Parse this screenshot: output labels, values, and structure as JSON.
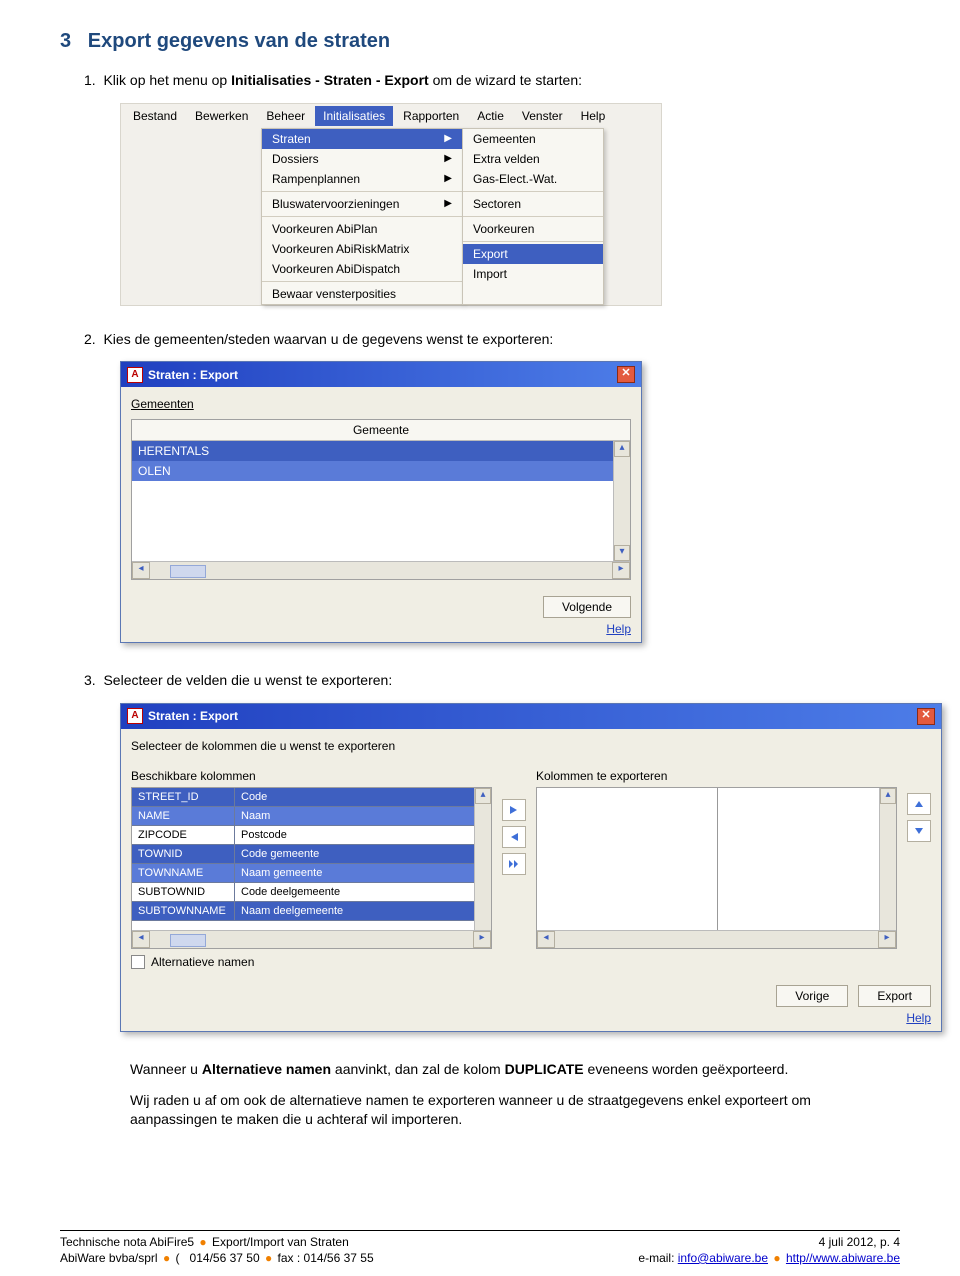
{
  "section": {
    "num": "3",
    "title": "Export gegevens van de straten"
  },
  "steps": {
    "s1a": "Klik op het menu op ",
    "s1b": "Initialisaties - Straten - Export",
    "s1c": " om de wizard te starten:",
    "s2": "Kies de gemeenten/steden waarvan u de gegevens wenst te exporteren:",
    "s3": "Selecteer de velden die u wenst te exporteren:"
  },
  "menubar": {
    "t1": "Bestand",
    "t2": "Bewerken",
    "t3": "Beheer",
    "t4": "Initialisaties",
    "t5": "Rapporten",
    "t6": "Actie",
    "t7": "Venster",
    "t8": "Help"
  },
  "dd1": {
    "straten": "Straten",
    "dossiers": "Dossiers",
    "rampen": "Rampenplannen",
    "blus": "Bluswatervoorzieningen",
    "vk1": "Voorkeuren AbiPlan",
    "vk2": "Voorkeuren AbiRiskMatrix",
    "vk3": "Voorkeuren AbiDispatch",
    "bewaar": "Bewaar vensterposities"
  },
  "dd2": {
    "gemeenten": "Gemeenten",
    "extra": "Extra velden",
    "gas": "Gas-Elect.-Wat.",
    "sectoren": "Sectoren",
    "voorkeuren": "Voorkeuren",
    "export": "Export",
    "import": "Import"
  },
  "dlg1": {
    "title": "Straten : Export",
    "tabGemeenten": "Gemeenten",
    "colhdr": "Gemeente",
    "row1": "HERENTALS",
    "row2": "OLEN",
    "btnVolgende": "Volgende",
    "help": "Help"
  },
  "dlg2": {
    "title": "Straten : Export",
    "prompt": "Selecteer de kolommen die u wenst te exporteren",
    "leftlbl": "Beschikbare kolommen",
    "rightlbl": "Kolommen te exporteren",
    "rows": [
      {
        "a": "STREET_ID",
        "b": "Code"
      },
      {
        "a": "NAME",
        "b": "Naam"
      },
      {
        "a": "ZIPCODE",
        "b": "Postcode"
      },
      {
        "a": "TOWNID",
        "b": "Code gemeente"
      },
      {
        "a": "TOWNNAME",
        "b": "Naam gemeente"
      },
      {
        "a": "SUBTOWNID",
        "b": "Code deelgemeente"
      },
      {
        "a": "SUBTOWNNAME",
        "b": "Naam deelgemeente"
      }
    ],
    "chkAlt": "Alternatieve namen",
    "btnVorige": "Vorige",
    "btnExport": "Export",
    "help": "Help"
  },
  "body": {
    "p1a": "Wanneer u ",
    "p1b": "Alternatieve namen",
    "p1c": " aanvinkt, dan zal de kolom ",
    "p1d": "DUPLICATE",
    "p1e": " eveneens worden geëxporteerd.",
    "p2": "Wij raden u af om ook de alternatieve namen te exporteren wanneer u de straatgegevens enkel exporteert om aanpassingen te maken die u achteraf wil importeren."
  },
  "footer": {
    "l1a": "Technische nota AbiFire5 ",
    "l1b": "Export/Import van Straten",
    "l2a": "AbiWare bvba/sprl ",
    "l2b": "( ",
    "l2c": "014/56 37 50 ",
    "l2d": "fax : 014/56 37 55",
    "r1": "4 juli 2012, p. 4",
    "r2a": "e-mail: ",
    "r2b": "info@abiware.be",
    "r2c": "http//www.abiware.be"
  }
}
